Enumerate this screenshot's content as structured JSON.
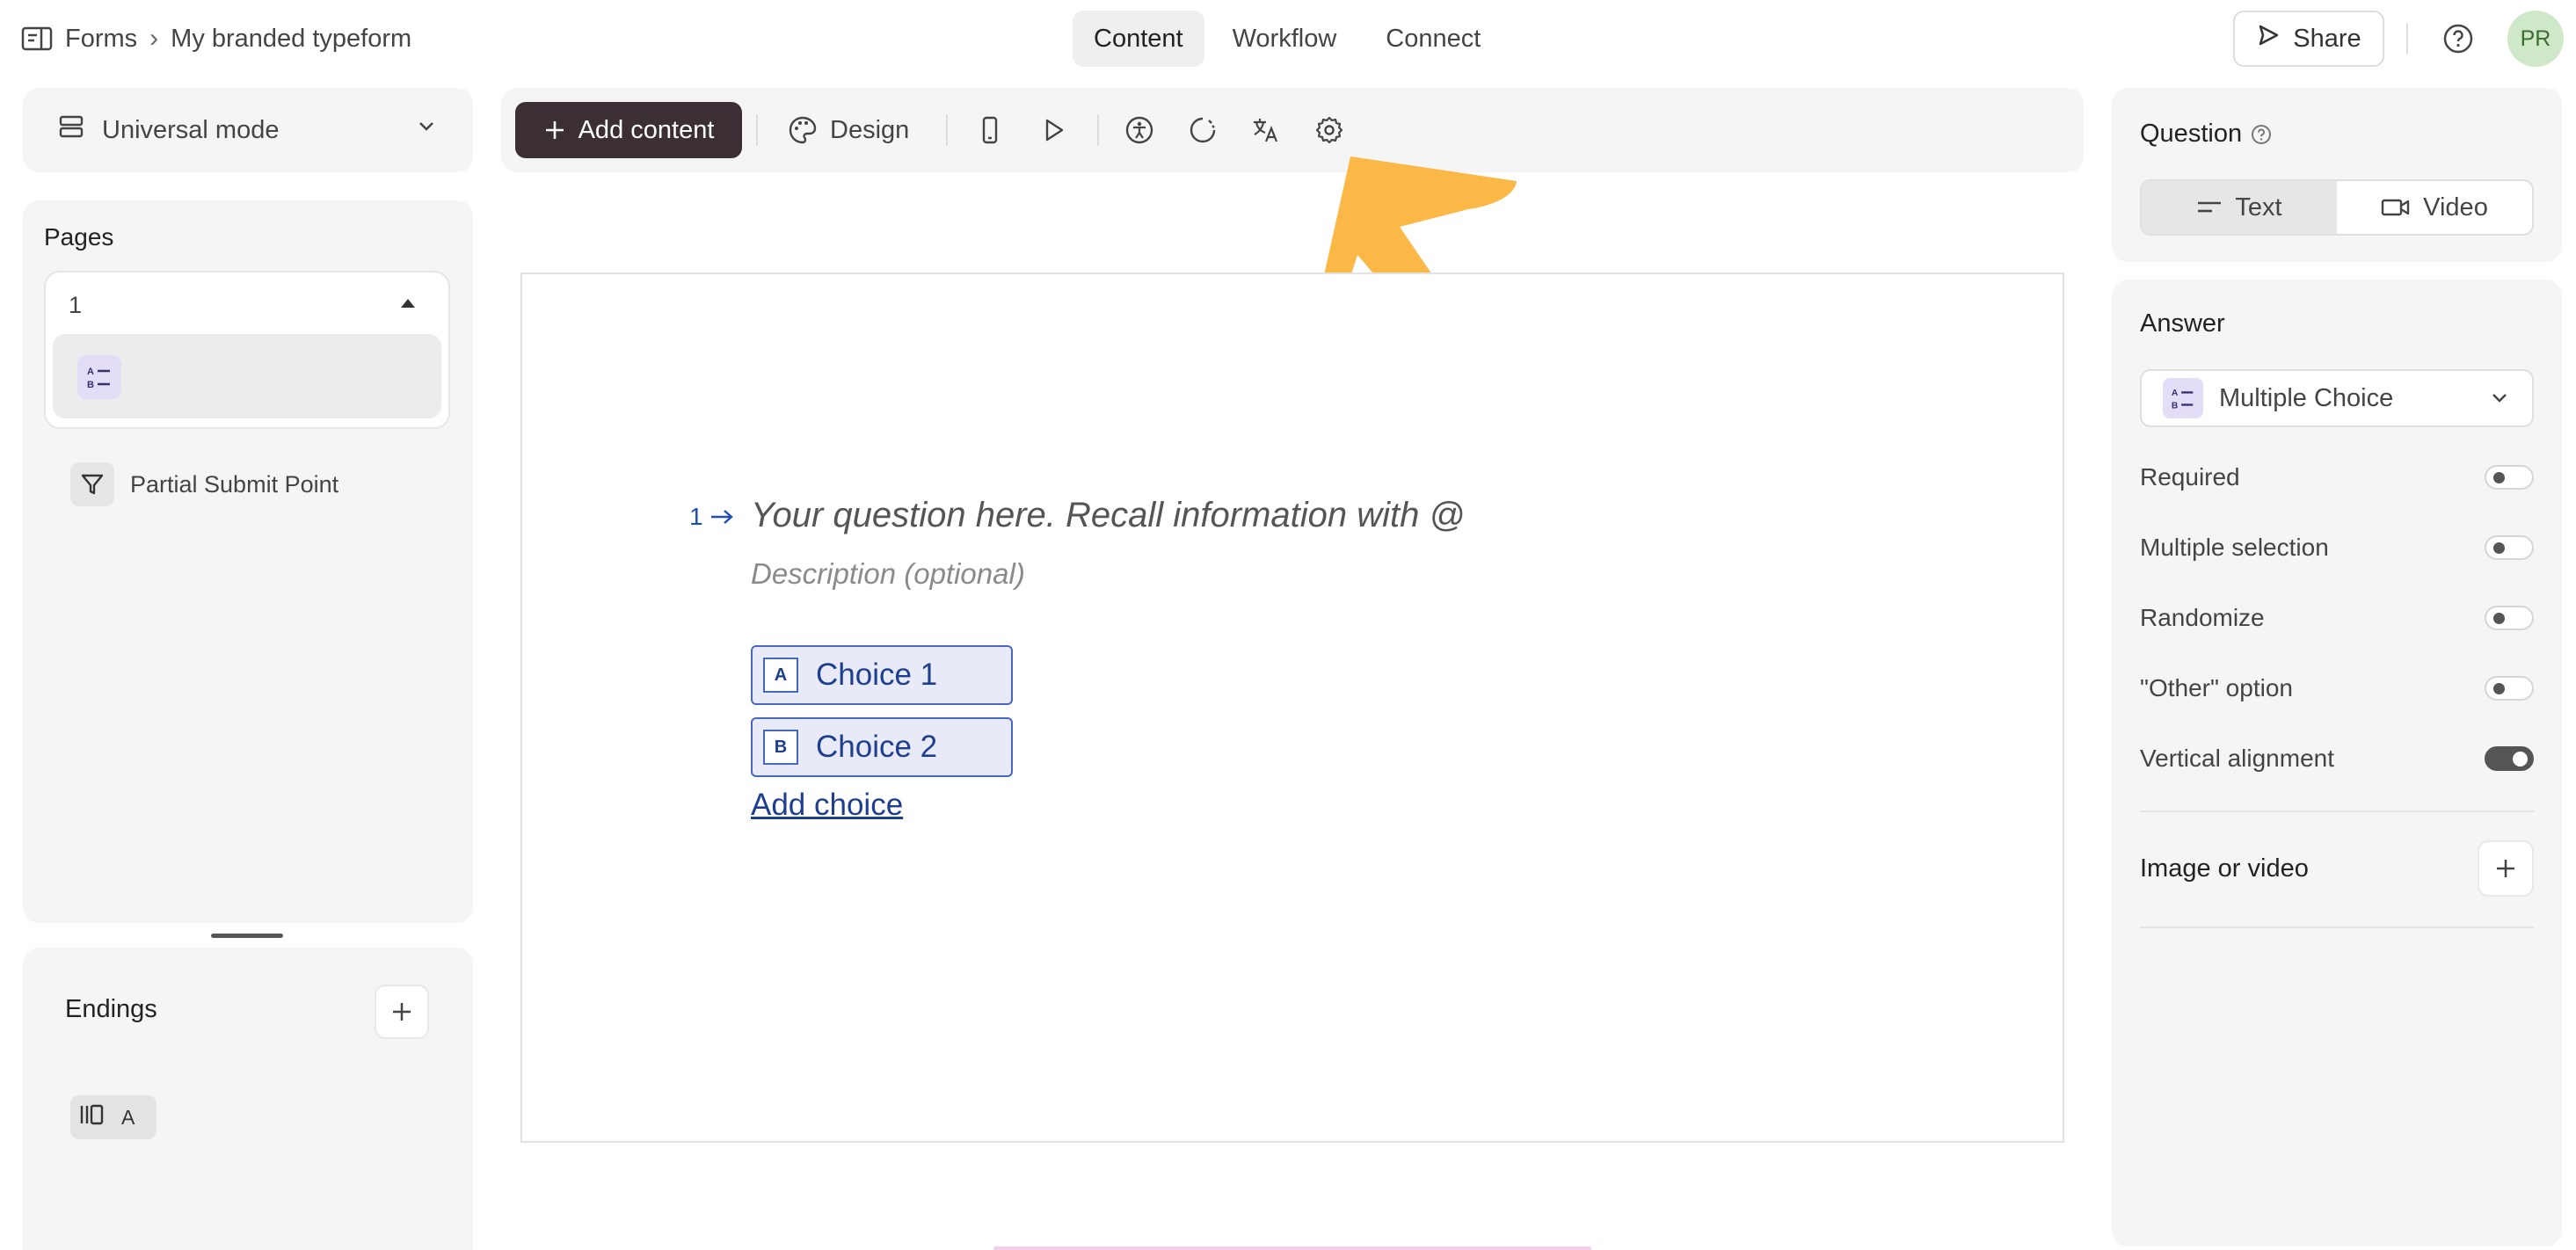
{
  "breadcrumb": {
    "root": "Forms",
    "separator": "›",
    "title": "My branded typeform",
    "root_icon": "forms-icon"
  },
  "nav_tabs": [
    {
      "label": "Content",
      "active": true
    },
    {
      "label": "Workflow",
      "active": false
    },
    {
      "label": "Connect",
      "active": false
    }
  ],
  "header_actions": {
    "share_label": "Share",
    "help_icon": "help-circle-icon",
    "avatar_initials": "PR",
    "avatar_color": "#cfe8c7"
  },
  "mode_selector": {
    "label": "Universal mode",
    "icon": "layout-rows-icon"
  },
  "pages_panel": {
    "title": "Pages",
    "page_number": "1",
    "page_item_icon": "multiple-choice-icon",
    "partial_submit_label": "Partial Submit Point"
  },
  "endings_panel": {
    "title": "Endings",
    "ending_item_label": "A"
  },
  "toolbar": {
    "add_content_label": "Add content",
    "design_label": "Design",
    "icons": [
      "mobile-preview-icon",
      "play-icon",
      "accessibility-icon",
      "loading-icon",
      "translate-icon",
      "settings-icon"
    ]
  },
  "question": {
    "number": "1",
    "placeholder_text": "Your question here. Recall information with @",
    "description_placeholder": "Description (optional)",
    "choices": [
      {
        "key": "A",
        "label": "Choice 1"
      },
      {
        "key": "B",
        "label": "Choice 2"
      }
    ],
    "add_choice_label": "Add choice"
  },
  "question_settings": {
    "title": "Question",
    "type_options": [
      {
        "label": "Text",
        "active": true
      },
      {
        "label": "Video",
        "active": false
      }
    ]
  },
  "answer_settings": {
    "title": "Answer",
    "answer_type": "Multiple Choice",
    "options": [
      {
        "label": "Required",
        "on": false
      },
      {
        "label": "Multiple selection",
        "on": false
      },
      {
        "label": "Randomize",
        "on": false
      },
      {
        "label": "\"Other\" option",
        "on": false
      },
      {
        "label": "Vertical alignment",
        "on": true
      }
    ],
    "media_label": "Image or video"
  },
  "colors": {
    "accent_dark": "#3b2f35",
    "choice_blue": "#1e3f8f",
    "annotation_arrow": "#fbb847"
  }
}
